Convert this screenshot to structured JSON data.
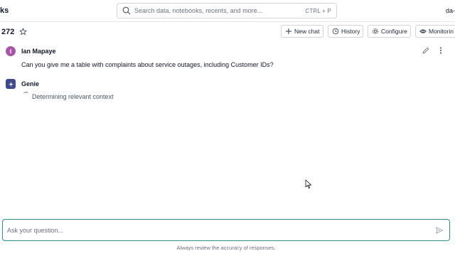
{
  "header": {
    "brand_fragment": "ks",
    "search_placeholder": "Search data, notebooks, recents, and more...",
    "search_shortcut": "CTRL + P",
    "account_fragment": "da-"
  },
  "space": {
    "title": "272",
    "buttons": {
      "new_chat": "New chat",
      "history": "History",
      "configure": "Configure",
      "monitoring": "Monitorin"
    }
  },
  "conversation": {
    "user": {
      "initial": "I",
      "name": "Ian Mapaye",
      "message": "Can you give me a table with complaints about service outages, including Customer IDs?",
      "avatar_color": "#a855a8"
    },
    "assistant": {
      "name": "Genie",
      "status": "Determining relevant context",
      "avatar_color": "#3f4a8c"
    }
  },
  "composer": {
    "placeholder": "Ask your question...",
    "disclaimer": "Always review the accuracy of responses.",
    "border_color": "#2d8f8b"
  },
  "icons": [
    "search-icon",
    "star-icon",
    "plus-icon",
    "history-icon",
    "gear-icon",
    "eye-icon",
    "pencil-icon",
    "more-vertical-icon",
    "sparkle-icon",
    "send-icon"
  ]
}
